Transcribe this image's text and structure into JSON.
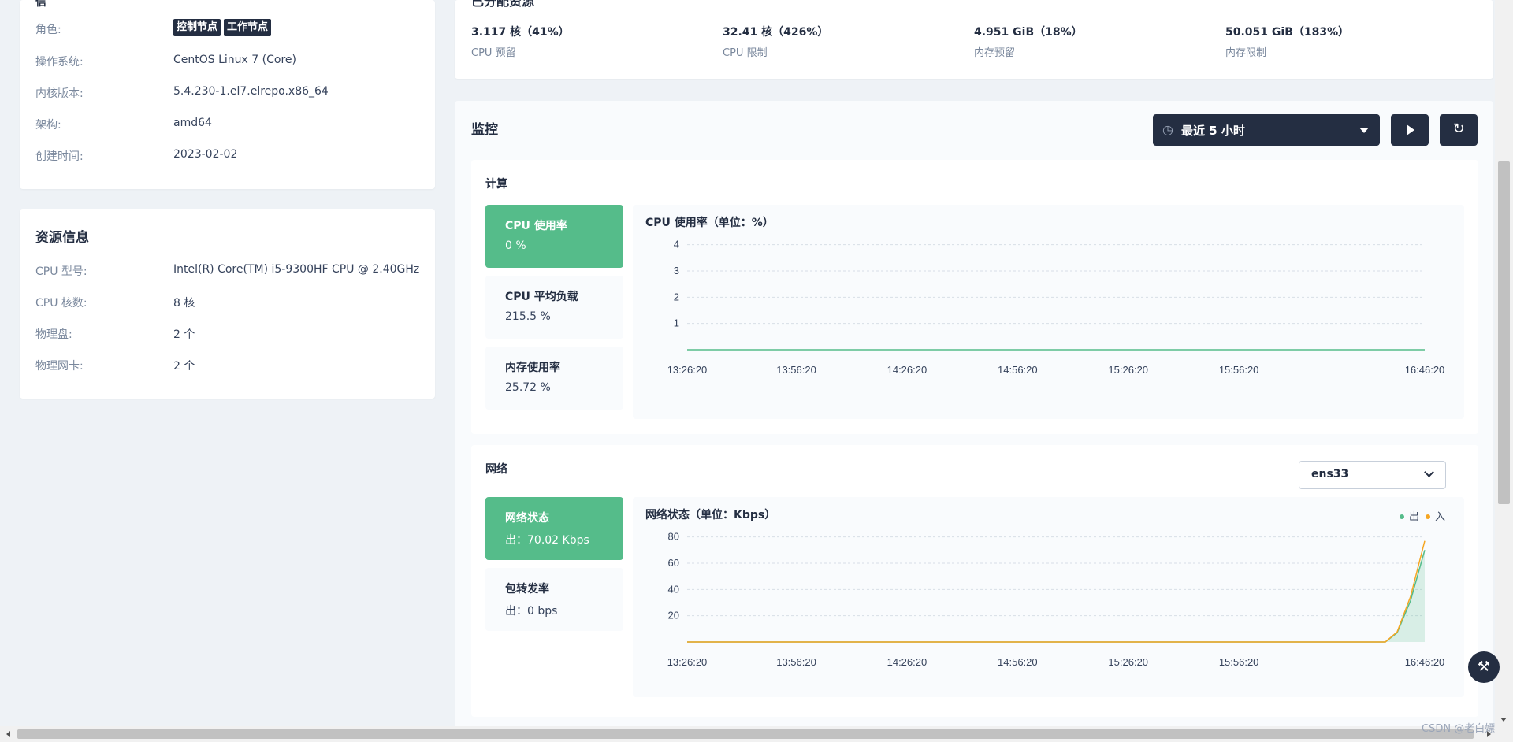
{
  "node_info": {
    "cut_title": "信",
    "rows": [
      {
        "key": "角色:",
        "tags": [
          "控制节点",
          "工作节点"
        ]
      },
      {
        "key": "操作系统:",
        "value": "CentOS Linux 7 (Core)"
      },
      {
        "key": "内核版本:",
        "value": "5.4.230-1.el7.elrepo.x86_64"
      },
      {
        "key": "架构:",
        "value": "amd64"
      },
      {
        "key": "创建时间:",
        "value": "2023-02-02"
      }
    ]
  },
  "resource_info": {
    "title": "资源信息",
    "rows": [
      {
        "key": "CPU 型号:",
        "value": "Intel(R) Core(TM) i5-9300HF CPU @ 2.40GHz"
      },
      {
        "key": "CPU 核数:",
        "value": "8 核"
      },
      {
        "key": "物理盘:",
        "value": "2 个"
      },
      {
        "key": "物理网卡:",
        "value": "2 个"
      }
    ]
  },
  "allocated": {
    "cut_title": "已分配资源",
    "stats": [
      {
        "value": "3.117 核（41%）",
        "label": "CPU 预留"
      },
      {
        "value": "32.41 核（426%）",
        "label": "CPU 限制"
      },
      {
        "value": "4.951 GiB（18%）",
        "label": "内存预留"
      },
      {
        "value": "50.051 GiB（183%）",
        "label": "内存限制"
      }
    ]
  },
  "monitor": {
    "title": "监控",
    "time_range": "最近 5 小时",
    "compute": {
      "title": "计算",
      "metrics": [
        {
          "label": "CPU 使用率",
          "value": "0 %",
          "active": true
        },
        {
          "label": "CPU 平均负载",
          "value": "215.5 %",
          "active": false
        },
        {
          "label": "内存使用率",
          "value": "25.72 %",
          "active": false
        }
      ]
    },
    "network": {
      "title": "网络",
      "interface": "ens33",
      "metrics": [
        {
          "label": "网络状态",
          "value": "出：70.02 Kbps",
          "active": true
        },
        {
          "label": "包转发率",
          "value": "出：0 bps",
          "active": false
        }
      ]
    }
  },
  "chart_data": [
    {
      "type": "line",
      "title": "CPU 使用率（单位：%）",
      "x": [
        "13:26:20",
        "13:56:20",
        "14:26:20",
        "14:56:20",
        "15:26:20",
        "15:56:20",
        "16:46:20"
      ],
      "yticks": [
        1,
        2,
        3,
        4
      ],
      "ylim": [
        0,
        4.5
      ],
      "series": [
        {
          "values": [
            0,
            0,
            0,
            0,
            0,
            0,
            0
          ],
          "color": "#55bc8a"
        }
      ],
      "grid": true
    },
    {
      "type": "area",
      "title": "网络状态（单位：Kbps）",
      "x": [
        "13:26:20",
        "13:56:20",
        "14:26:20",
        "14:56:20",
        "15:26:20",
        "15:56:20",
        "16:46:20"
      ],
      "yticks": [
        20,
        40,
        60,
        80
      ],
      "ylim": [
        0,
        90
      ],
      "legend": [
        {
          "name": "出",
          "color": "#55bc8a"
        },
        {
          "name": "入",
          "color": "#f5a623"
        }
      ],
      "legend_position": "top-right",
      "series": [
        {
          "name": "出",
          "color": "#55bc8a",
          "values": [
            0,
            0,
            0,
            0,
            0,
            0,
            0,
            70
          ]
        },
        {
          "name": "入",
          "color": "#f5a623",
          "values": [
            0,
            0,
            0,
            0,
            0,
            0,
            0,
            77
          ]
        }
      ],
      "grid": true
    }
  ],
  "floating_tool": {
    "icon": "hammer-icon"
  },
  "watermark": "CSDN @老白嫖"
}
